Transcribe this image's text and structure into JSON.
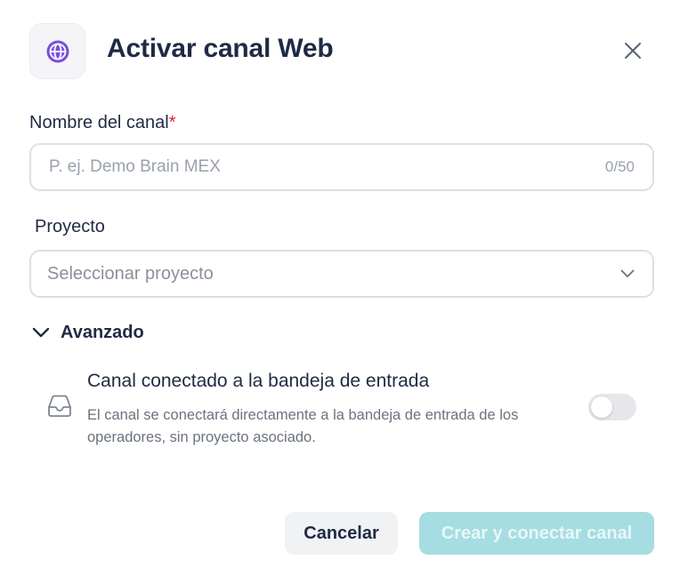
{
  "header": {
    "title": "Activar canal Web",
    "icon": "globe-icon",
    "icon_color": "#7b4ee0"
  },
  "name_field": {
    "label": "Nombre del canal",
    "required_mark": "*",
    "placeholder": "P. ej. Demo Brain MEX",
    "value": "",
    "counter": "0/50"
  },
  "project_field": {
    "label": "Proyecto",
    "placeholder": "Seleccionar proyecto"
  },
  "advanced": {
    "label": "Avanzado",
    "expanded": true,
    "option": {
      "title": "Canal conectado a la bandeja de entrada",
      "description": "El canal se conectará directamente a la bandeja de entrada de los operadores, sin proyecto asociado.",
      "enabled": false
    }
  },
  "footer": {
    "cancel_label": "Cancelar",
    "submit_label": "Crear y conectar canal",
    "submit_color": "#a6dde2"
  }
}
